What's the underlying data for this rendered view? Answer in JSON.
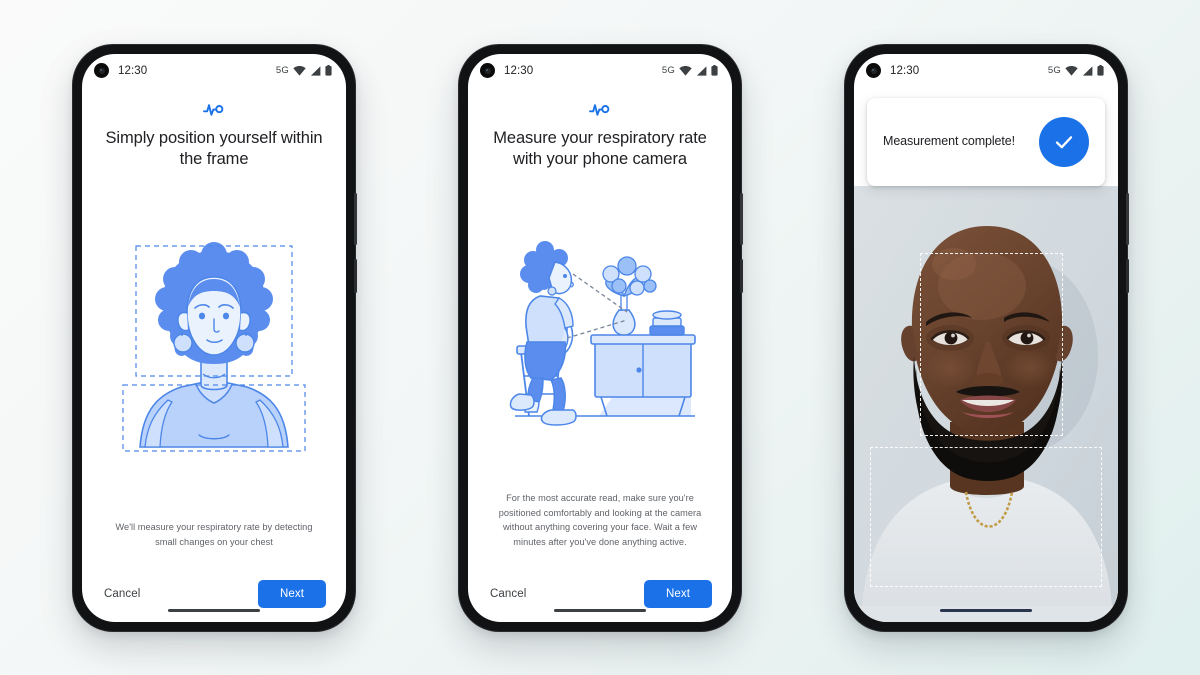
{
  "background": {
    "from": "#fafafa",
    "to": "#dff0ee"
  },
  "accent": "#1b72e8",
  "status_bar": {
    "time": "12:30",
    "network": "5G",
    "icons": [
      "camera-punchhole",
      "wifi-icon",
      "cellular-signal-icon",
      "battery-icon"
    ]
  },
  "phones": [
    {
      "id": "phone-position-frame",
      "header_icon": "pulse-heartbeat-icon",
      "title": "Simply position yourself within the frame",
      "illustration": "person-in-framing-guides-illustration",
      "body": "We'll measure your respiratory rate by detecting small changes on your chest",
      "cancel_label": "Cancel",
      "next_label": "Next"
    },
    {
      "id": "phone-setup-instructions",
      "header_icon": "pulse-heartbeat-icon",
      "title": "Measure your respiratory rate with your phone camera",
      "illustration": "person-on-stool-facing-phone-illustration",
      "body": "For the most accurate read, make sure you're positioned comfortably and looking at the camera without anything covering your face. Wait a few minutes after you've done anything active.",
      "cancel_label": "Cancel",
      "next_label": "Next"
    },
    {
      "id": "phone-measurement-complete",
      "toast_text": "Measurement complete!",
      "toast_icon": "checkmark-icon",
      "viewfinder": "live-camera-preview-of-person",
      "tracking_boxes": [
        "face-tracking-box",
        "chest-tracking-box"
      ]
    }
  ]
}
